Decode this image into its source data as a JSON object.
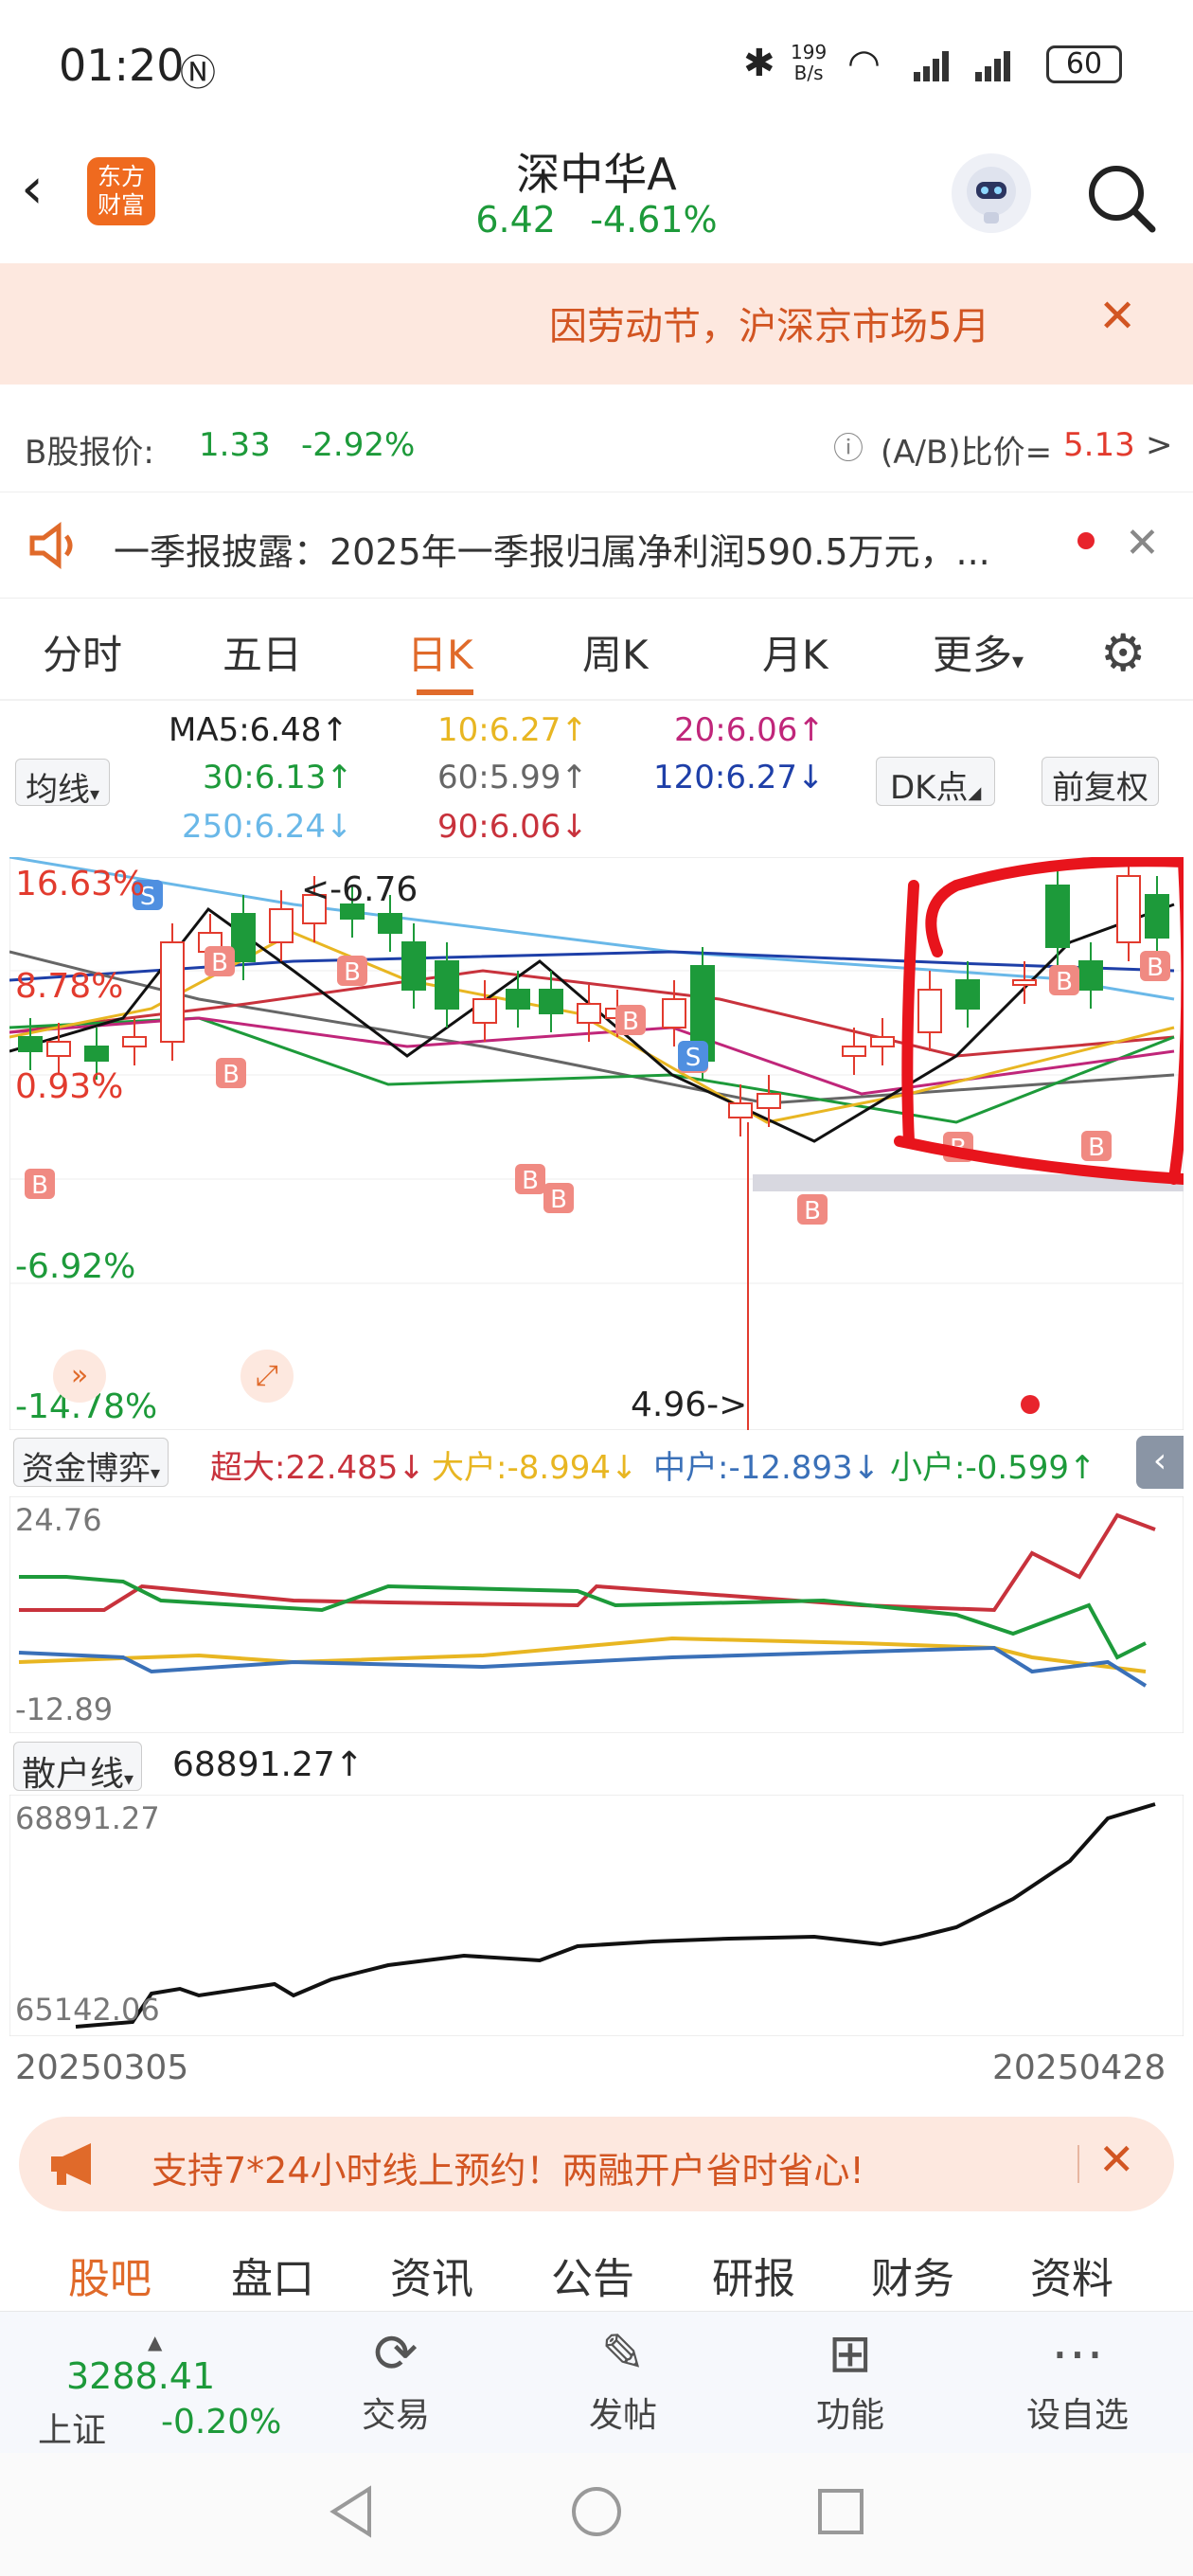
{
  "status": {
    "time": "01:20",
    "net_speed_top": "199",
    "net_speed_unit": "B/s",
    "battery": "60"
  },
  "header": {
    "logo_line1": "东方",
    "logo_line2": "财富",
    "name": "深中华A",
    "price": "6.42",
    "change": "-4.61%"
  },
  "notice": {
    "text": "因劳动节，沪深京市场5月"
  },
  "bshare": {
    "label": "B股报价:",
    "price": "1.33",
    "change": "-2.92%",
    "ratio_label": "(A/B)比价=",
    "ratio_value": "5.13",
    "arrow": ">"
  },
  "report": {
    "text": "一季报披露：2025年一季报归属净利润590.5万元，..."
  },
  "tabs": [
    {
      "label": "分时",
      "active": false
    },
    {
      "label": "五日",
      "active": false
    },
    {
      "label": "日K",
      "active": true
    },
    {
      "label": "周K",
      "active": false
    },
    {
      "label": "月K",
      "active": false
    },
    {
      "label": "更多",
      "active": false
    }
  ],
  "ma": {
    "selector": "均线",
    "ma5": "MA5:6.48↑",
    "ma10": "10:6.27↑",
    "ma20": "20:6.06↑",
    "ma30": "30:6.13↑",
    "ma60": "60:5.99↑",
    "ma120": "120:6.27↓",
    "ma250": "250:6.24↓",
    "ma90": "90:6.06↓",
    "dk_button": "DK点",
    "adjust_button": "前复权"
  },
  "kline": {
    "pct_labels": [
      "16.63%",
      "8.78%",
      "0.93%",
      "-6.92%",
      "-14.78%"
    ],
    "high_marker": "<-6.76",
    "low_marker": "4.96->",
    "buy_label": "B",
    "sell_label": "S"
  },
  "fund": {
    "selector": "资金博弈",
    "super": "超大:22.485↓",
    "big": "大户:-8.994↓",
    "mid": "中户:-12.893↓",
    "small": "小户:-0.599↑",
    "ymax": "24.76",
    "ymin": "-12.89"
  },
  "retail": {
    "selector": "散户线",
    "value": "68891.27↑",
    "ymax": "68891.27",
    "ymin": "65142.06"
  },
  "dates": {
    "start": "20250305",
    "end": "20250428"
  },
  "promo": {
    "text": "支持7*24小时线上预约！两融开户省时省心!"
  },
  "bottom_tabs": [
    "股吧",
    "盘口",
    "资讯",
    "公告",
    "研报",
    "财务",
    "资料"
  ],
  "index": {
    "value": "3288.41",
    "name": "上证",
    "change": "-0.20%"
  },
  "nav": [
    {
      "label": "交易",
      "icon": "trade-icon"
    },
    {
      "label": "发帖",
      "icon": "post-icon"
    },
    {
      "label": "功能",
      "icon": "apps-icon"
    },
    {
      "label": "设自选",
      "icon": "more-icon"
    }
  ],
  "chart_data": {
    "type": "candlestick",
    "series": [
      {
        "name": "资金博弈 超大",
        "color": "#c8323c"
      },
      {
        "name": "大户",
        "color": "#e8b622"
      },
      {
        "name": "中户",
        "color": "#3a70b8"
      },
      {
        "name": "小户",
        "color": "#1d9a3a"
      },
      {
        "name": "散户线",
        "color": "#111111"
      }
    ],
    "colors": {
      "up": "#e23b2e",
      "down": "#1d9a3a",
      "ma250": "#6ab8e8",
      "ma120": "#1e3fa8"
    }
  }
}
